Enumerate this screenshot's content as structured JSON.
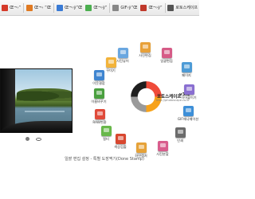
{
  "toolbar": {
    "items": [
      {
        "label": "Œ¬›”",
        "color": "#d53a2a",
        "icon": "flag-icon"
      },
      {
        "label": "Œ¬› ”Œ",
        "color": "#e07a22",
        "icon": "folder-icon"
      },
      {
        "label": "Œ¬›ÿ”Œ",
        "color": "#3a7bd5",
        "icon": "folder-icon"
      },
      {
        "label": "Œ¬›ÿ”",
        "color": "#4caf50",
        "icon": "document-icon"
      },
      {
        "label": "GIF›ÿ”Œ",
        "color": "#888888",
        "icon": "gif-icon"
      },
      {
        "label": "Œ¬›ÿ”",
        "color": "#c0392b",
        "icon": "flag-icon"
      },
      {
        "label": "로토스케이프",
        "color": "#555555",
        "icon": "app-icon"
      }
    ]
  },
  "caption": "일괄 편집 설정 - 특별 도장찍기(Done Stamp)",
  "logo": {
    "title": "포토스케이프",
    "version": "v3.5",
    "url": "http://photoscape.co.kr",
    "colors": [
      "#1e1e1e",
      "#ef4b3a",
      "#f7a21a",
      "#9a9a9a"
    ]
  },
  "menu": [
    {
      "label": "사진뷰어",
      "color": "#6aa7e0",
      "icon": "viewer-icon"
    },
    {
      "label": "사진편집",
      "color": "#e8a13a",
      "icon": "editor-icon"
    },
    {
      "label": "일괄편집",
      "color": "#d65b87",
      "icon": "batch-editor-icon"
    },
    {
      "label": "페이지",
      "color": "#4d9bd6",
      "icon": "page-icon"
    },
    {
      "label": "이어붙이기",
      "color": "#8a6fd1",
      "icon": "combine-icon"
    },
    {
      "label": "GIF애니메이션",
      "color": "#3d8fd8",
      "icon": "animated-gif-icon"
    },
    {
      "label": "인쇄",
      "color": "#6b6b6b",
      "icon": "print-icon"
    },
    {
      "label": "사진분할",
      "color": "#d95c8c",
      "icon": "splitter-icon"
    },
    {
      "label": "화면캡처",
      "color": "#e6a238",
      "icon": "screen-capture-icon"
    },
    {
      "label": "색상검출",
      "color": "#d8472f",
      "icon": "color-picker-icon"
    },
    {
      "label": "이름바꾸기",
      "color": "#4aa03f",
      "icon": "rename-icon"
    },
    {
      "label": "RAW변환",
      "color": "#e04a3a",
      "icon": "raw-converter-icon"
    },
    {
      "label": "이웃결합",
      "color": "#3f85d0",
      "icon": "face-search-icon"
    },
    {
      "label": "필터",
      "color": "#68b84a",
      "icon": "filter-icon"
    },
    {
      "label": "꾸미기",
      "color": "#f2b33a",
      "icon": "decorate-icon"
    }
  ]
}
